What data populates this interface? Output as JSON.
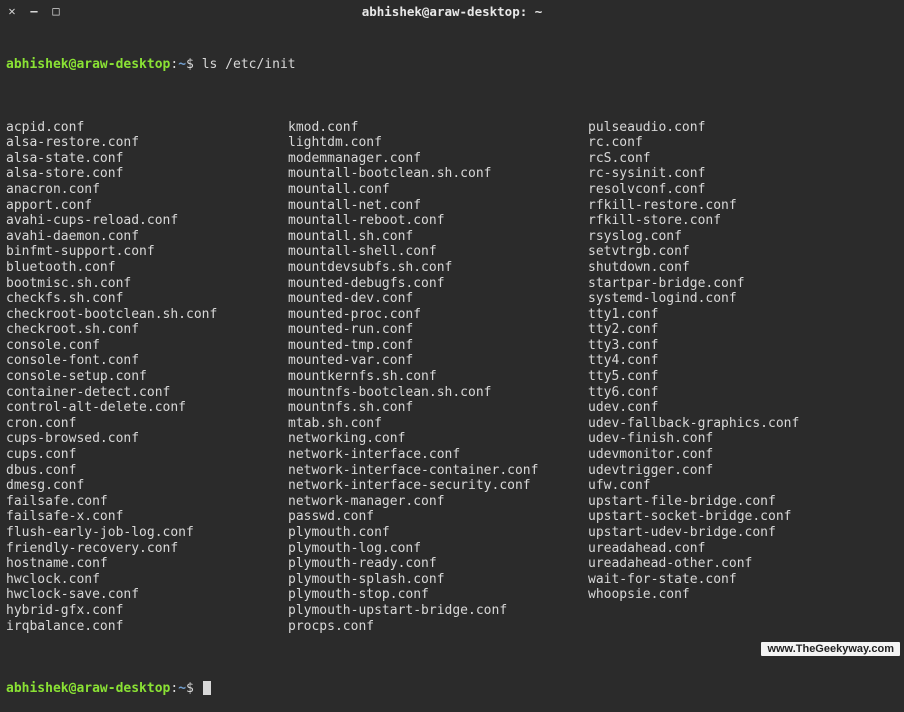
{
  "window": {
    "title": "abhishek@araw-desktop: ~"
  },
  "prompt": {
    "user_host": "abhishek@araw-desktop",
    "colon": ":",
    "path": "~",
    "dollar": "$",
    "command": "ls /etc/init"
  },
  "listing": {
    "col1": [
      "acpid.conf",
      "alsa-restore.conf",
      "alsa-state.conf",
      "alsa-store.conf",
      "anacron.conf",
      "apport.conf",
      "avahi-cups-reload.conf",
      "avahi-daemon.conf",
      "binfmt-support.conf",
      "bluetooth.conf",
      "bootmisc.sh.conf",
      "checkfs.sh.conf",
      "checkroot-bootclean.sh.conf",
      "checkroot.sh.conf",
      "console.conf",
      "console-font.conf",
      "console-setup.conf",
      "container-detect.conf",
      "control-alt-delete.conf",
      "cron.conf",
      "cups-browsed.conf",
      "cups.conf",
      "dbus.conf",
      "dmesg.conf",
      "failsafe.conf",
      "failsafe-x.conf",
      "flush-early-job-log.conf",
      "friendly-recovery.conf",
      "hostname.conf",
      "hwclock.conf",
      "hwclock-save.conf",
      "hybrid-gfx.conf",
      "irqbalance.conf"
    ],
    "col2": [
      "kmod.conf",
      "lightdm.conf",
      "modemmanager.conf",
      "mountall-bootclean.sh.conf",
      "mountall.conf",
      "mountall-net.conf",
      "mountall-reboot.conf",
      "mountall.sh.conf",
      "mountall-shell.conf",
      "mountdevsubfs.sh.conf",
      "mounted-debugfs.conf",
      "mounted-dev.conf",
      "mounted-proc.conf",
      "mounted-run.conf",
      "mounted-tmp.conf",
      "mounted-var.conf",
      "mountkernfs.sh.conf",
      "mountnfs-bootclean.sh.conf",
      "mountnfs.sh.conf",
      "mtab.sh.conf",
      "networking.conf",
      "network-interface.conf",
      "network-interface-container.conf",
      "network-interface-security.conf",
      "network-manager.conf",
      "passwd.conf",
      "plymouth.conf",
      "plymouth-log.conf",
      "plymouth-ready.conf",
      "plymouth-splash.conf",
      "plymouth-stop.conf",
      "plymouth-upstart-bridge.conf",
      "procps.conf"
    ],
    "col3": [
      "pulseaudio.conf",
      "rc.conf",
      "rcS.conf",
      "rc-sysinit.conf",
      "resolvconf.conf",
      "rfkill-restore.conf",
      "rfkill-store.conf",
      "rsyslog.conf",
      "setvtrgb.conf",
      "shutdown.conf",
      "startpar-bridge.conf",
      "systemd-logind.conf",
      "tty1.conf",
      "tty2.conf",
      "tty3.conf",
      "tty4.conf",
      "tty5.conf",
      "tty6.conf",
      "udev.conf",
      "udev-fallback-graphics.conf",
      "udev-finish.conf",
      "udevmonitor.conf",
      "udevtrigger.conf",
      "ufw.conf",
      "upstart-file-bridge.conf",
      "upstart-socket-bridge.conf",
      "upstart-udev-bridge.conf",
      "ureadahead.conf",
      "ureadahead-other.conf",
      "wait-for-state.conf",
      "whoopsie.conf"
    ]
  },
  "prompt2": {
    "user_host": "abhishek@araw-desktop",
    "colon": ":",
    "path": "~",
    "dollar": "$"
  },
  "icons": {
    "close": "✕",
    "minimize": "—",
    "maximize": "□"
  },
  "watermark": "www.TheGeekyway.com"
}
